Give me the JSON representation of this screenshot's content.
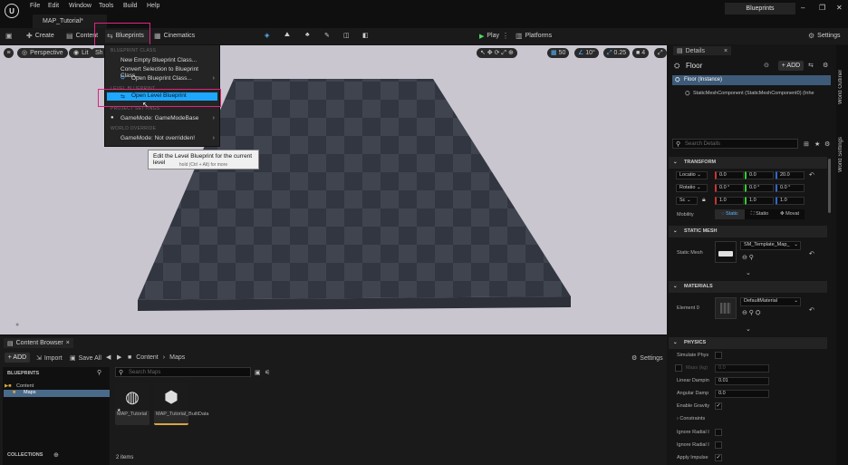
{
  "window": {
    "app_name": "Blueprints",
    "doc_tab": "MAP_Tutorial*",
    "menu": [
      "File",
      "Edit",
      "Window",
      "Tools",
      "Build",
      "Help"
    ],
    "controls": [
      "–",
      "❐",
      "✕"
    ]
  },
  "toolbar": {
    "create": "Create",
    "content": "Content",
    "blueprints": "Blueprints",
    "cinematics": "Cinematics",
    "play": "Play",
    "platforms": "Platforms",
    "settings": "Settings"
  },
  "viewport": {
    "perspective": "Perspective",
    "lit": "Lit",
    "show": "Sh",
    "grid_snap": "50",
    "rot_snap": "10°",
    "scale_snap": "0.25",
    "cam_speed": "4"
  },
  "blueprint_menu": {
    "section_blueprint_class": "BLUEPRINT CLASS",
    "new_empty": "New Empty Blueprint Class...",
    "convert": "Convert Selection to Blueprint Class...",
    "open_class": "Open Blueprint Class...",
    "section_level": "LEVEL BLUEPRINT",
    "open_level": "Open Level Blueprint",
    "section_project": "PROJECT SETTINGS",
    "gamemode_base": "GameMode: GameModeBase",
    "section_world": "WORLD OVERRIDE",
    "gamemode_none": "GameMode: Not overridden!"
  },
  "tooltip": {
    "title": "Edit the Level Blueprint for the current level",
    "hint": "hold (Ctrl + Alt) for more"
  },
  "content_browser": {
    "tab": "Content Browser",
    "add": "+ ADD",
    "import": "Import",
    "save_all": "Save All",
    "path": [
      "Content",
      "Maps"
    ],
    "settings": "Settings",
    "blueprints_header": "BLUEPRINTS",
    "tree_root": "Content",
    "tree_child": "Maps",
    "search_placeholder": "Search Maps",
    "collections": "COLLECTIONS",
    "item_count": "2 items",
    "assets": [
      {
        "name": "MAP_Tutorial",
        "icon": "globe-icon"
      },
      {
        "name": "MAP_Tutorial_BuiltData",
        "icon": "cube-icon"
      }
    ]
  },
  "details": {
    "tab": "Details",
    "actor": "Floor",
    "add": "+ ADD",
    "instance": "Floor (Instance)",
    "component": "StaticMeshComponent (StaticMeshComponent0) (Inhe",
    "search_placeholder": "Search Details",
    "transform": "TRANSFORM",
    "location_label": "Locatio",
    "location": [
      "0.0",
      "0.0",
      "20.0"
    ],
    "rotation_label": "Rotatio",
    "rotation": [
      "0.0 °",
      "0.0 °",
      "0.0 °"
    ],
    "scale_label": "Sc",
    "scale": [
      "1.0",
      "1.0",
      "1.0"
    ],
    "mobility_label": "Mobility",
    "mobility": [
      "Static",
      "Statio",
      "Movat"
    ],
    "static_mesh_section": "STATIC MESH",
    "static_mesh_label": "Static Mesh",
    "static_mesh_value": "SM_Template_Map_",
    "materials_section": "MATERIALS",
    "element_label": "Element 0",
    "material_value": "DefaultMaterial",
    "physics_section": "PHYSICS",
    "simulate": "Simulate Phys",
    "mass": "Mass (kg)",
    "mass_value": "0.0",
    "linear_damping": "Linear Dampin",
    "linear_value": "0.01",
    "angular_damping": "Angular Damp",
    "angular_value": "0.0",
    "enable_gravity": "Enable Gravity",
    "constraints": "Constraints",
    "ignore_radial_1": "Ignore Radial I",
    "ignore_radial_2": "Ignore Radial I",
    "apply_impulse": "Apply Impulse"
  },
  "right_strip": {
    "outliner": "World Outliner",
    "world_settings": "World Settings"
  }
}
